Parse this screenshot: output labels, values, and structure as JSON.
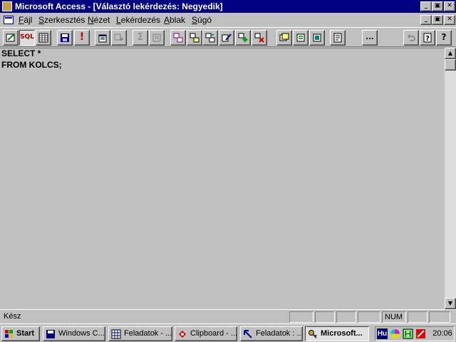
{
  "window": {
    "title": "Microsoft Access - [Választó lekérdezés: Negyedik]"
  },
  "caption_buttons": {
    "minimize": "_",
    "restore": "▣",
    "close": "✕"
  },
  "menu": {
    "items": [
      "Fájl",
      "Szerkesztés",
      "Nézet",
      "Lekérdezés",
      "Ablak",
      "Súgó"
    ]
  },
  "toolbar": {
    "sql_label": "SQL",
    "run_label": "!",
    "totals_label": "Σ",
    "build_label": "...",
    "help_label": "?"
  },
  "editor": {
    "lines": [
      "SELECT *",
      "FROM KOLCS;"
    ]
  },
  "scrollbar": {
    "up": "▲",
    "down": "▼"
  },
  "statusbar": {
    "text": "Kész",
    "num_indicator": "NUM"
  },
  "taskbar": {
    "start_label": "Start",
    "tasks": [
      {
        "label": "Windows C...",
        "icon": "floppy-icon"
      },
      {
        "label": "Feladatok - ...",
        "icon": "grid-icon"
      },
      {
        "label": "Clipboard - ...",
        "icon": "clipboard-icon"
      },
      {
        "label": "Feladatok : ...",
        "icon": "arrow-icon"
      },
      {
        "label": "Microsoft...",
        "icon": "access-key-icon",
        "active": true
      }
    ],
    "tray": {
      "language": "Hu",
      "clock": "20:06"
    }
  },
  "colors": {
    "title_bar": "#000080",
    "face": "#c0c0c0"
  }
}
